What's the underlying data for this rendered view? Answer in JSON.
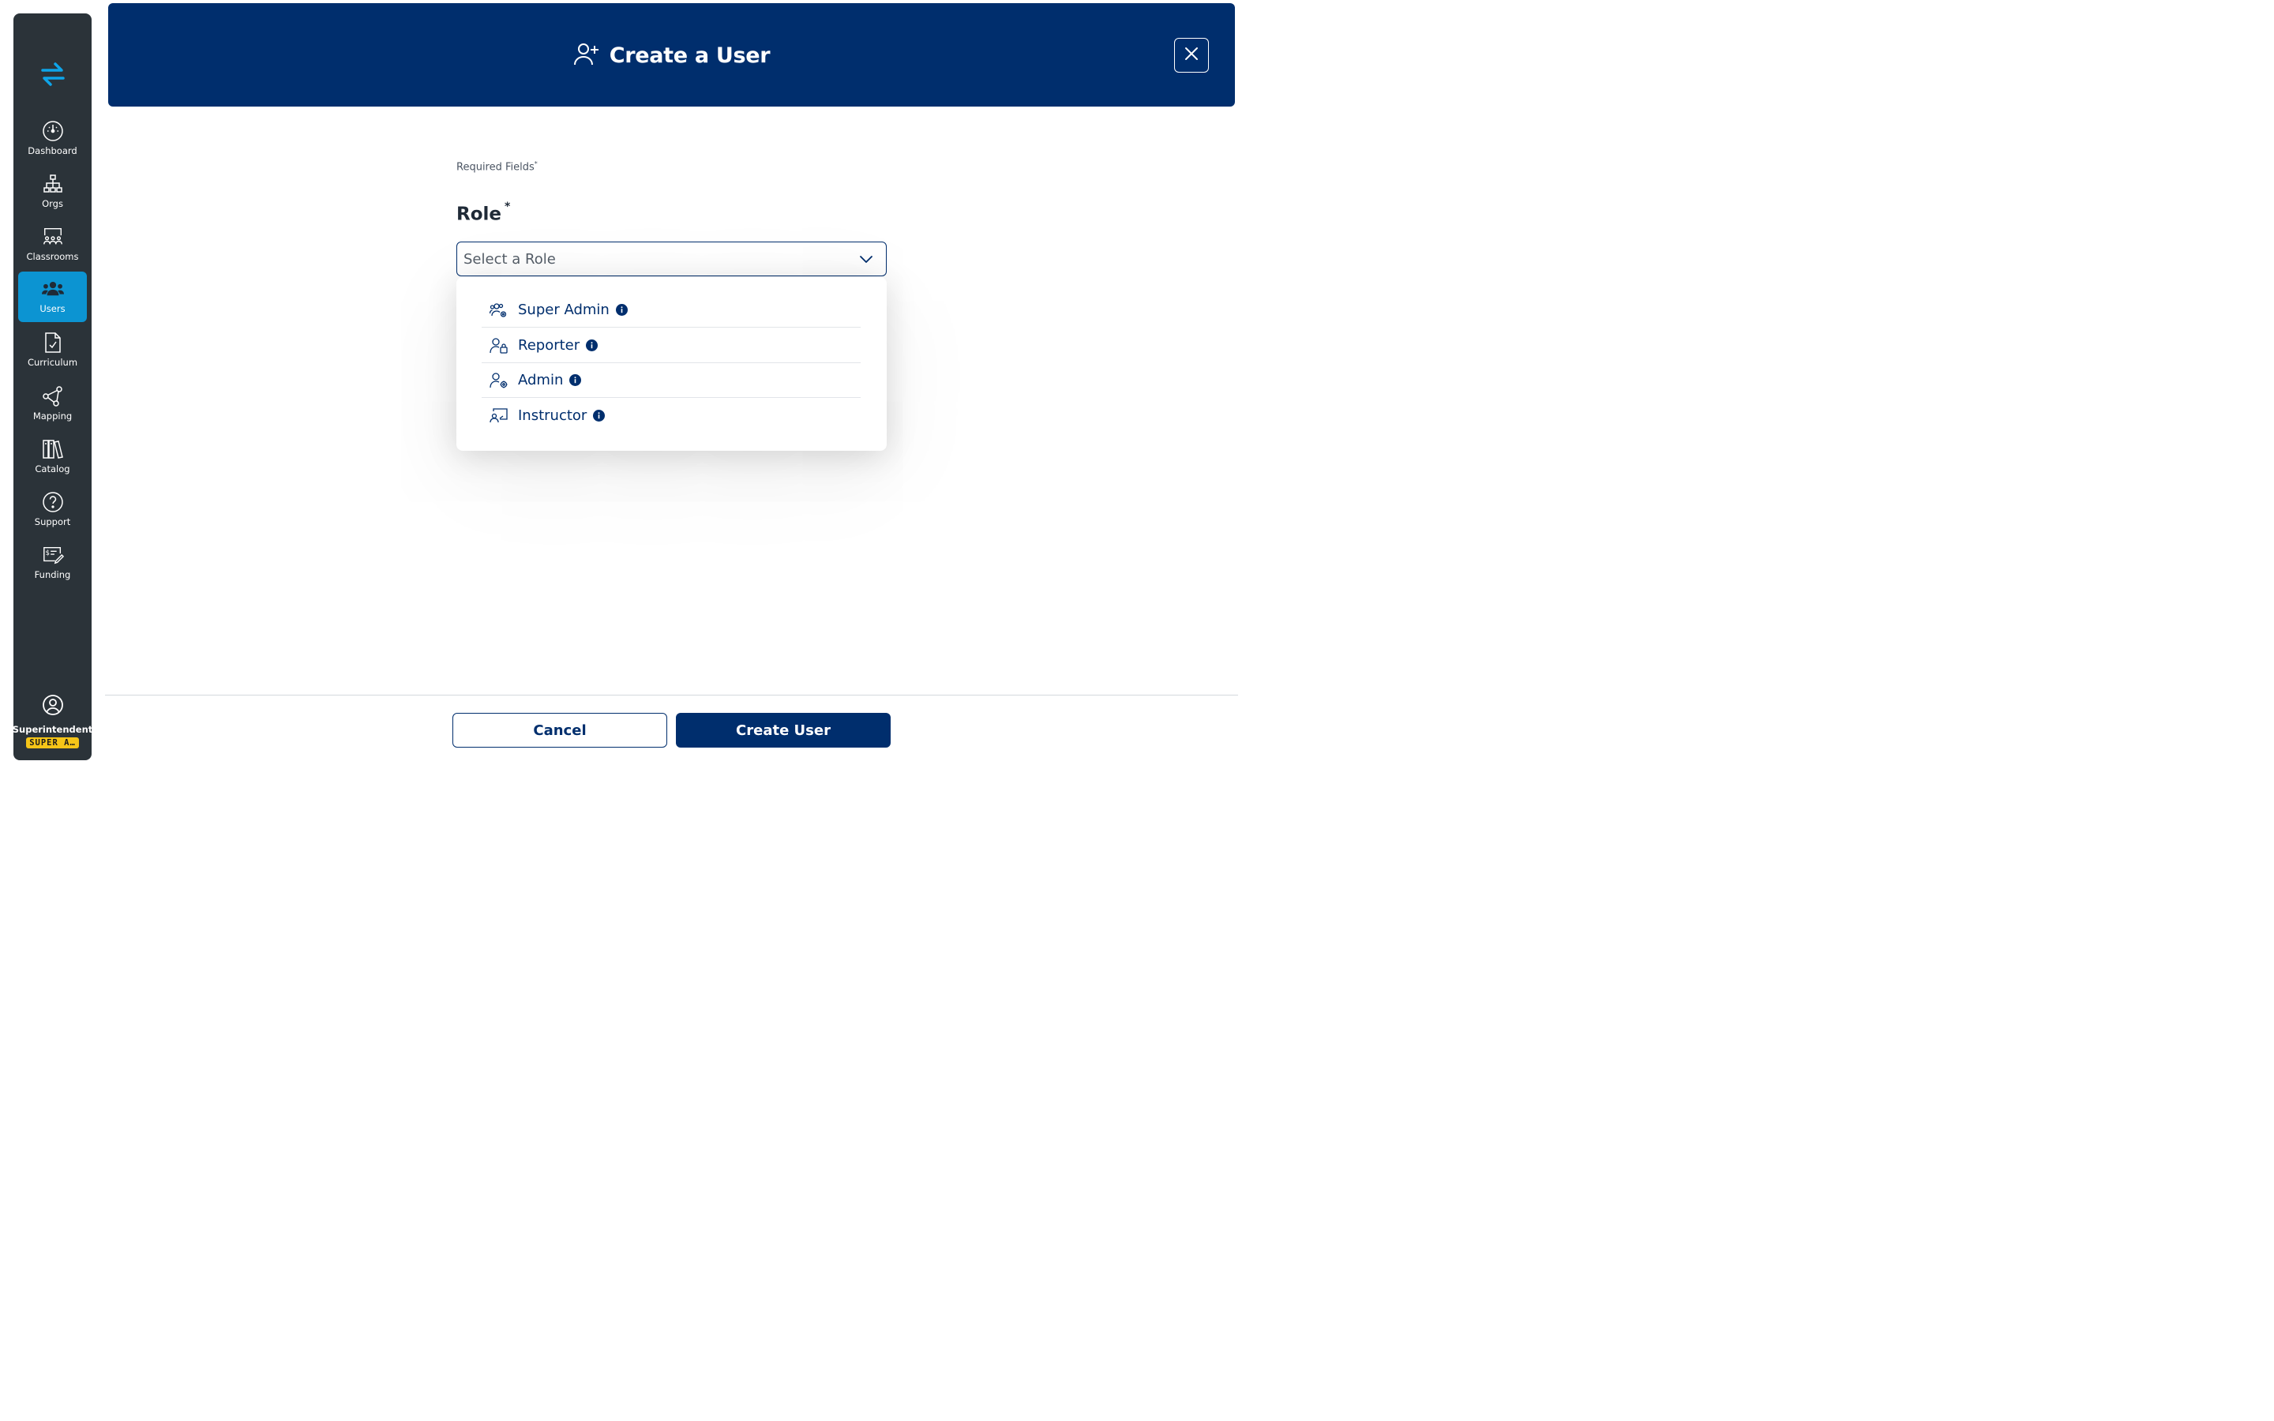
{
  "sidebar": {
    "logo_icon": "swap-arrows-icon",
    "items": [
      {
        "label": "Dashboard",
        "icon": "dashboard-gauge-icon"
      },
      {
        "label": "Orgs",
        "icon": "org-chart-icon"
      },
      {
        "label": "Classrooms",
        "icon": "classroom-icon"
      },
      {
        "label": "Users",
        "icon": "users-icon",
        "active": true
      },
      {
        "label": "Curriculum",
        "icon": "document-check-icon"
      },
      {
        "label": "Mapping",
        "icon": "share-nodes-icon"
      },
      {
        "label": "Catalog",
        "icon": "books-icon"
      },
      {
        "label": "Support",
        "icon": "help-circle-icon"
      },
      {
        "label": "Funding",
        "icon": "funding-check-icon"
      }
    ],
    "profile": {
      "name": "Superintendent",
      "badge": "SUPER A…",
      "icon": "user-circle-icon"
    }
  },
  "header": {
    "title": "Create a User",
    "icon": "user-plus-icon",
    "close_icon": "close-icon"
  },
  "form": {
    "required_note": "Required Fields",
    "required_mark": "*",
    "role_label": "Role",
    "role_required_mark": "*",
    "role_placeholder": "Select a Role",
    "role_options": [
      {
        "label": "Super Admin",
        "icon": "users-gear-icon"
      },
      {
        "label": "Reporter",
        "icon": "user-lock-icon"
      },
      {
        "label": "Admin",
        "icon": "user-gear-icon"
      },
      {
        "label": "Instructor",
        "icon": "presentation-icon"
      }
    ]
  },
  "footer": {
    "cancel_label": "Cancel",
    "create_label": "Create User"
  },
  "colors": {
    "sidebar_bg": "#2b3339",
    "active_nav": "#0c94d2",
    "brand_navy": "#002e6d",
    "badge_yellow": "#f5c518"
  }
}
